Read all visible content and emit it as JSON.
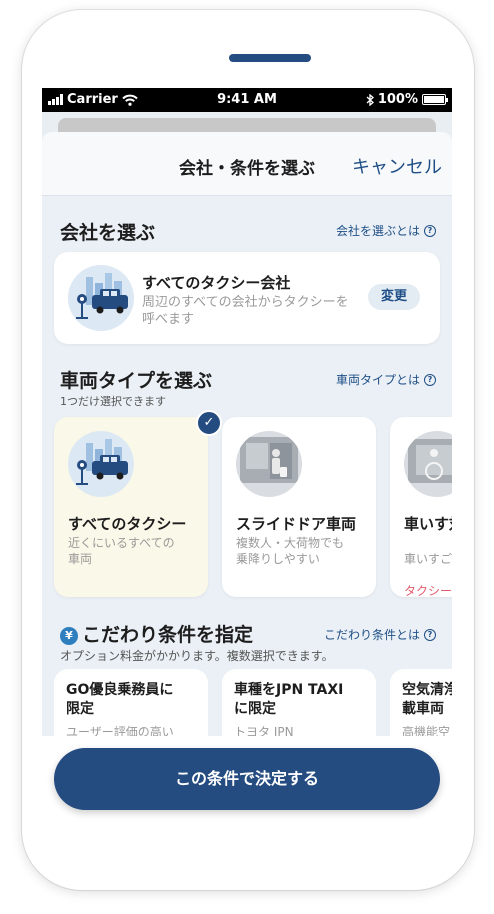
{
  "status_bar": {
    "carrier": "Carrier",
    "time": "9:41 AM",
    "battery": "100%"
  },
  "header": {
    "title": "会社・条件を選ぶ",
    "cancel_label": "キャンセル"
  },
  "company_section": {
    "title": "会社を選ぶ",
    "help_link": "会社を選ぶとは",
    "card": {
      "name": "すべてのタクシー会社",
      "description": "周辺のすべての会社からタクシーを呼べます",
      "change_label": "変更"
    }
  },
  "vehicle_section": {
    "title": "車両タイプを選ぶ",
    "help_link": "車両タイプとは",
    "subtitle": "1つだけ選択できます",
    "types": [
      {
        "name": "すべてのタクシー",
        "description": "近くにいるすべての\n車両",
        "selected": true
      },
      {
        "name": "スライドドア車両",
        "description": "複数人・大荷物でも\n乗降りしやすい",
        "selected": false
      },
      {
        "name": "車いす対",
        "description": "車いすご",
        "note": "タクシー\n車両指定",
        "selected": false
      }
    ]
  },
  "options_section": {
    "yen_symbol": "¥",
    "title": "こだわり条件を指定",
    "help_link": "こだわり条件とは",
    "subtitle": "オプション料金がかかります。複数選択できます。",
    "options": [
      {
        "title": "GO優良乗務員に\n限定",
        "description": "ユーザー評価の高い"
      },
      {
        "title": "車種をJPN TAXI\nに限定",
        "description": "トヨタ JPN"
      },
      {
        "title": "空気清浄\n載車両",
        "description": "高機能空"
      }
    ]
  },
  "confirm_button": {
    "label": "この条件で決定する"
  },
  "colors": {
    "accent": "#254c80",
    "link": "#1f4f86",
    "selected_card": "#faf8e8",
    "note": "#e05b6c"
  }
}
